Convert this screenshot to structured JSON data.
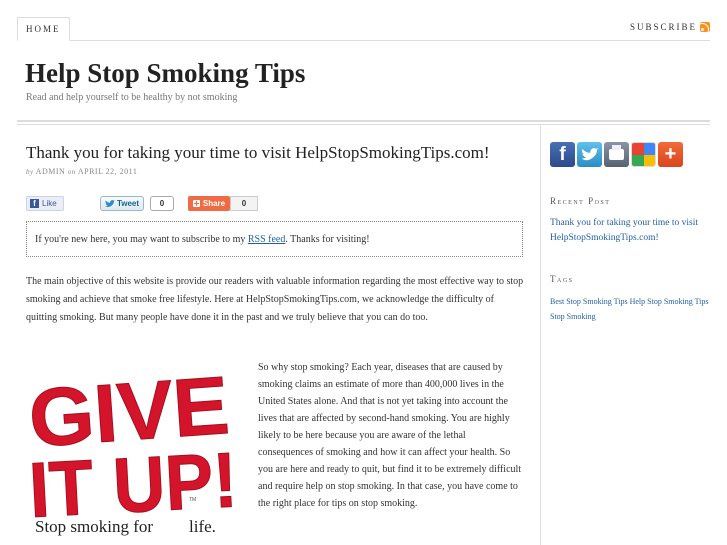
{
  "nav": {
    "home_label": "HOME",
    "subscribe_label": "SUBSCRIBE"
  },
  "header": {
    "site_title": "Help Stop Smoking Tips",
    "tagline": "Read and help yourself to be healthy by not smoking"
  },
  "post": {
    "title": "Thank you for taking your time to visit HelpStopSmokingTips.com!",
    "byline_prefix": "by",
    "author": "ADMIN",
    "byline_on": "on",
    "date": "APRIL 22, 2011",
    "share": {
      "fb_like_label": "Like",
      "fb_icon": "f",
      "tweet_label": "Tweet",
      "tweet_count": "0",
      "share_label": "Share",
      "share_count": "0"
    },
    "notice": {
      "before_link": "If you're new here, you may want to subscribe to my ",
      "link_text": "RSS feed",
      "after_link": ". Thanks for visiting!"
    },
    "paragraph_1": "The main objective of this website is provide our readers with valuable information regarding the most effective way to stop smoking and achieve that smoke free lifestyle. Here at HelpStopSmokingTips.com, we acknowledge the difficulty of quitting smoking. But many people have done it in the past and we truly believe that you can do too.",
    "paragraph_2": "So why stop smoking? Each year, diseases that are caused by smoking claims an estimate of more than 400,000 lives in the United States alone. And that is not yet taking into account the lives that are affected by second-hand smoking. You are highly likely to be here because you are aware of the lethal consequences of smoking and how it can affect your health. So you are here and ready to quit, but find it to be extremely difficult and require help on stop smoking. In that case, you have come to the right place for tips on stop smoking.",
    "image": {
      "line1": "GIVE",
      "line2": "IT UP!",
      "tm": "TM",
      "caption_left": "Stop smoking for",
      "caption_right": "life."
    }
  },
  "sidebar": {
    "social_icons": [
      "facebook-icon",
      "twitter-icon",
      "print-icon",
      "google-icon",
      "add-icon"
    ],
    "fb_glyph": "f",
    "tw_glyph": "t",
    "add_glyph": "+",
    "recent_heading": "Recent Post",
    "recent_posts": [
      "Thank you for taking your time to visit HelpStopSmokingTips.com!"
    ],
    "tags_heading": "Tags",
    "tags": [
      "Best Stop Smoking Tips",
      "Help Stop Smoking Tips",
      "Stop Smoking"
    ]
  },
  "colors": {
    "link": "#2361a1",
    "rss": "#f7931e",
    "give_it_up_red": "#d4142a",
    "share_orange": "#ee6b44"
  }
}
